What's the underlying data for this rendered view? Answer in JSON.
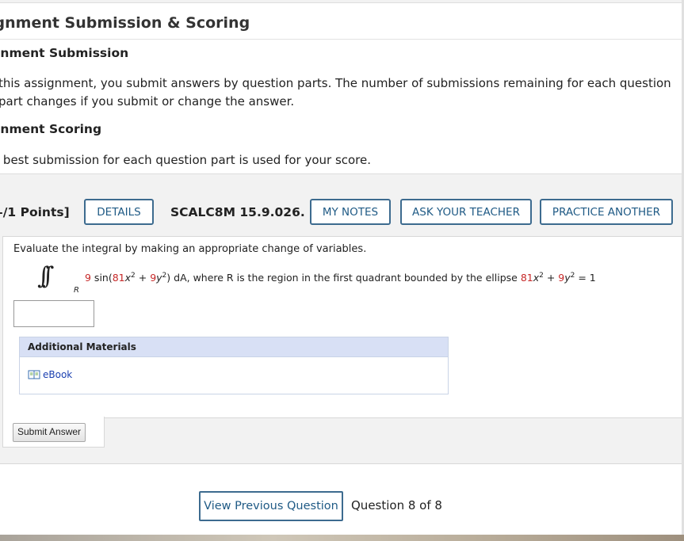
{
  "info": {
    "title": "ignment Submission & Scoring",
    "submission_heading": "ignment Submission",
    "submission_text": "this assignment, you submit answers by question parts. The number of submissions remaining for each question part changes if you submit or change the answer.",
    "scoring_heading": "ignment Scoring",
    "scoring_text": "r best submission for each question part is used for your score."
  },
  "question": {
    "points": "–/1 Points]",
    "details_label": "DETAILS",
    "code": "SCALC8M 15.9.026.",
    "notes_label": "MY NOTES",
    "teacher_label": "ASK YOUR TEACHER",
    "practice_label": "PRACTICE ANOTHER",
    "prompt": "Evaluate the integral by making an appropriate change of variables.",
    "integrand_coef": "9",
    "integrand_fn": " sin(",
    "term1_coef": "81",
    "term1_var": "x",
    "exp1": "2",
    "plus": " + ",
    "term2_coef": "9",
    "term2_var": "y",
    "exp2": "2",
    "close_da": ") dA,",
    "region_text": "  where R is the region in the first quadrant bounded by the ellipse  ",
    "ell_coef1": "81",
    "ell_var1": "x",
    "ell_exp1": "2",
    "ell_plus": " + ",
    "ell_coef2": "9",
    "ell_var2": "y",
    "ell_exp2": "2",
    "ell_rhs": " = 1",
    "region_symbol": "R",
    "answer_value": ""
  },
  "materials": {
    "heading": "Additional Materials",
    "ebook_label": "eBook"
  },
  "submit_label": "Submit Answer",
  "nav": {
    "prev_label": "View Previous Question",
    "count_text": "Question 8 of 8"
  },
  "icons": {
    "ebook": "book-icon"
  },
  "colors": {
    "accent": "#1f5a85",
    "math_red": "#c62828",
    "materials_header": "#d8e0f5"
  }
}
